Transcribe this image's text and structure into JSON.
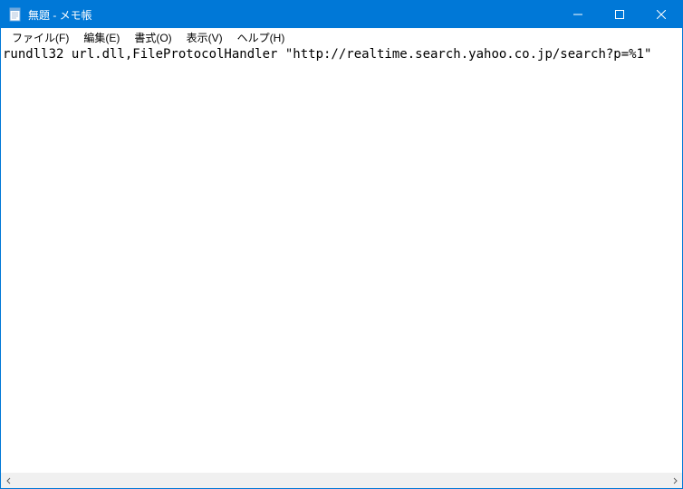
{
  "window": {
    "title": "無題 - メモ帳"
  },
  "menu": {
    "file": "ファイル(F)",
    "edit": "編集(E)",
    "format": "書式(O)",
    "view": "表示(V)",
    "help": "ヘルプ(H)"
  },
  "editor": {
    "content": "rundll32 url.dll,FileProtocolHandler \"http://realtime.search.yahoo.co.jp/search?p=%1\""
  }
}
